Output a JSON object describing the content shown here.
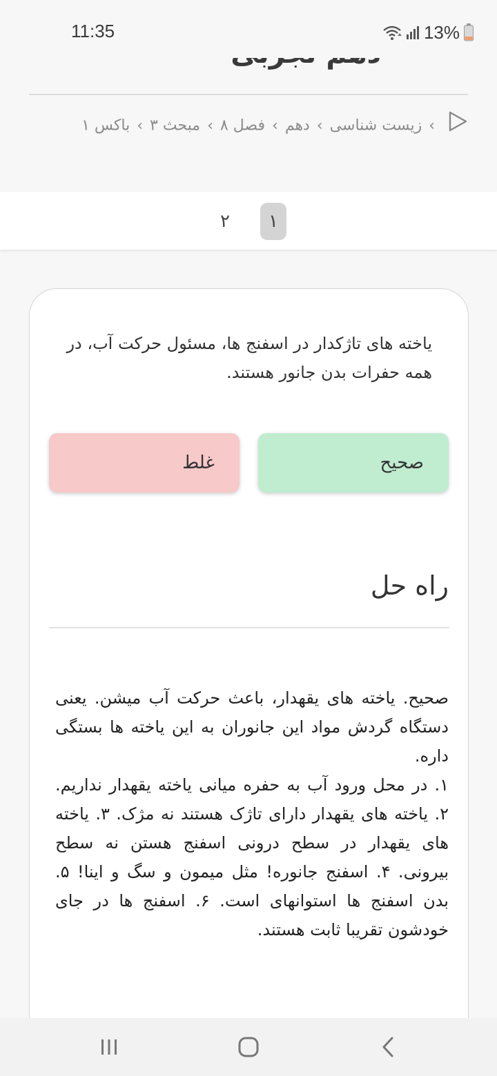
{
  "status_bar": {
    "time": "11:35",
    "battery": "13%",
    "battery_color": "#f39a6b"
  },
  "header": {
    "title": "دهم تجربی"
  },
  "breadcrumb": {
    "items": [
      "زیست شناسی",
      "دهم",
      "فصل ۸",
      "مبحث ۳",
      "باکس ۱"
    ]
  },
  "pager": {
    "pages": [
      "۱",
      "۲"
    ],
    "active_page": "۱"
  },
  "question": {
    "text": "یاخته های تاژکدار در اسفنج ها، مسئول حرکت آب، در همه حفرات بدن جانور هستند."
  },
  "answers": {
    "true_label": "صحیح",
    "false_label": "غلط",
    "true_color": "#c0ecd0",
    "false_color": "#f7c9c9"
  },
  "solution": {
    "title": "راه حل",
    "paragraph_1": "صحیح. یاخته های یقهدار، باعث حرکت آب میشن. یعنی دستگاه گردش مواد این جانوران به این یاخته ها بستگی داره.",
    "paragraph_2": "۱. در محل ورود آب به حفره میانی یاخته یقهدار نداریم. ۲. یاخته های یقهدار دارای تاژک هستند نه مژک. ۳. یاخته های یقهدار در سطح درونی اسفنج هستن نه سطح بیرونی. ۴. اسفنج جانوره! مثل میمون و سگ و اینا! ۵. بدن اسفنج ها استوانهای است. ۶. اسفنج ها در جای خودشون تقریبا ثابت هستند."
  },
  "nav_bar": {
    "icons": [
      "recents-icon",
      "home-icon",
      "back-icon"
    ]
  }
}
